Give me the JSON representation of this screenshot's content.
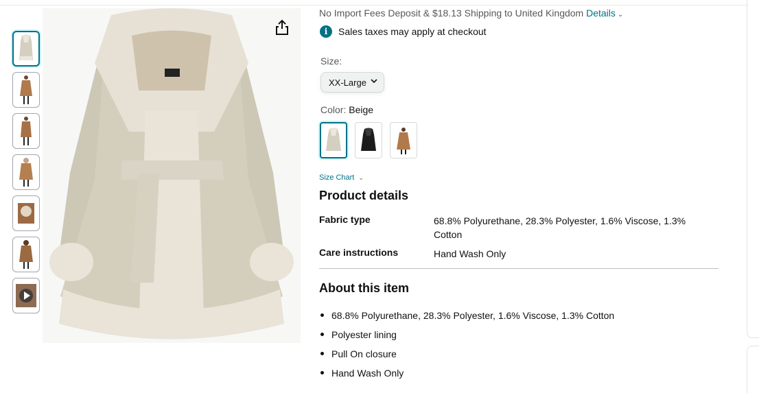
{
  "shipping": {
    "text": "No Import Fees Deposit & $18.13 Shipping to United Kingdom",
    "details_link": "Details"
  },
  "taxes": {
    "icon": "info-icon",
    "text": "Sales taxes may apply at checkout"
  },
  "size": {
    "label": "Size:",
    "selected": "XX-Large"
  },
  "color": {
    "label": "Color:",
    "selected": "Beige",
    "swatches": [
      "beige",
      "black",
      "brown"
    ]
  },
  "size_chart": {
    "label": "Size Chart"
  },
  "product_details": {
    "title": "Product details",
    "rows": [
      {
        "key": "Fabric type",
        "value": "68.8% Polyurethane, 28.3% Polyester, 1.6% Viscose, 1.3% Cotton"
      },
      {
        "key": "Care instructions",
        "value": "Hand Wash Only"
      }
    ]
  },
  "about": {
    "title": "About this item",
    "bullets": [
      "68.8% Polyurethane, 28.3% Polyester, 1.6% Viscose, 1.3% Cotton",
      "Polyester lining",
      "Pull On closure",
      "Hand Wash Only"
    ]
  },
  "gallery": {
    "thumbnails": [
      "coat-beige",
      "coat-brown",
      "coat-brown-side",
      "coat-brown-hood",
      "coat-detail",
      "coat-brown-back",
      "video"
    ],
    "selected": "coat-beige",
    "share_icon": "share-icon"
  },
  "colors": {
    "link": "#007185",
    "text": "#0f1111",
    "muted": "#565959",
    "coat_beige": "#d8d3c4",
    "fur": "#e6e0d4"
  }
}
